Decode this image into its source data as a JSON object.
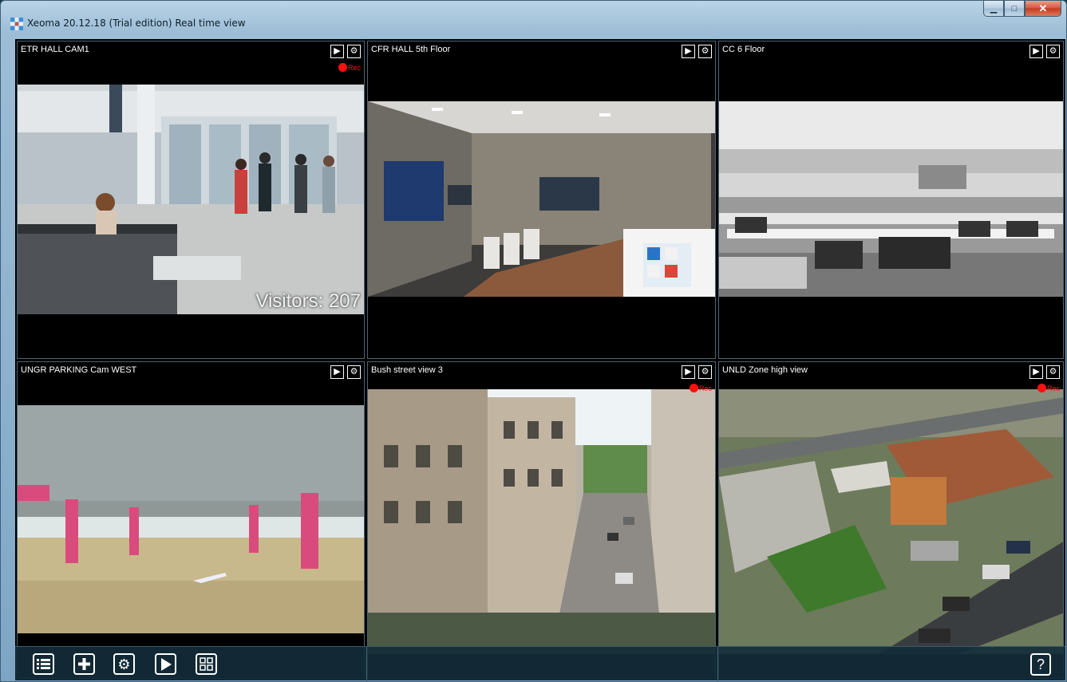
{
  "window": {
    "title": "Xeoma 20.12.18 (Trial edition) Real time view",
    "controls": {
      "minimize": "▁",
      "maximize": "□",
      "close": "✕"
    }
  },
  "cameras": [
    {
      "name": "ETR HALL CAM1",
      "recording": true,
      "rec_label": "Rec",
      "overlay": "Visitors: 207"
    },
    {
      "name": "CFR HALL 5th Floor",
      "recording": false
    },
    {
      "name": "CC 6 Floor",
      "recording": false
    },
    {
      "name": "UNGR PARKING Cam WEST",
      "recording": false
    },
    {
      "name": "Bush street view 3",
      "recording": true,
      "rec_label": "Rec"
    },
    {
      "name": "UNLD Zone high view",
      "recording": true,
      "rec_label": "Rec"
    }
  ],
  "camera_controls": {
    "play_icon": "play-icon",
    "settings_icon": "gear-icon"
  },
  "bottom_bar": {
    "items": [
      {
        "icon": "list-icon"
      },
      {
        "icon": "plus-icon"
      },
      {
        "icon": "gear-icon"
      },
      {
        "icon": "play-icon"
      },
      {
        "icon": "layout-grid-icon"
      }
    ],
    "help_label": "?"
  },
  "colors": {
    "rec": "#ff1010",
    "titlebar": "#b9d3e6",
    "border": "#4b6575"
  }
}
